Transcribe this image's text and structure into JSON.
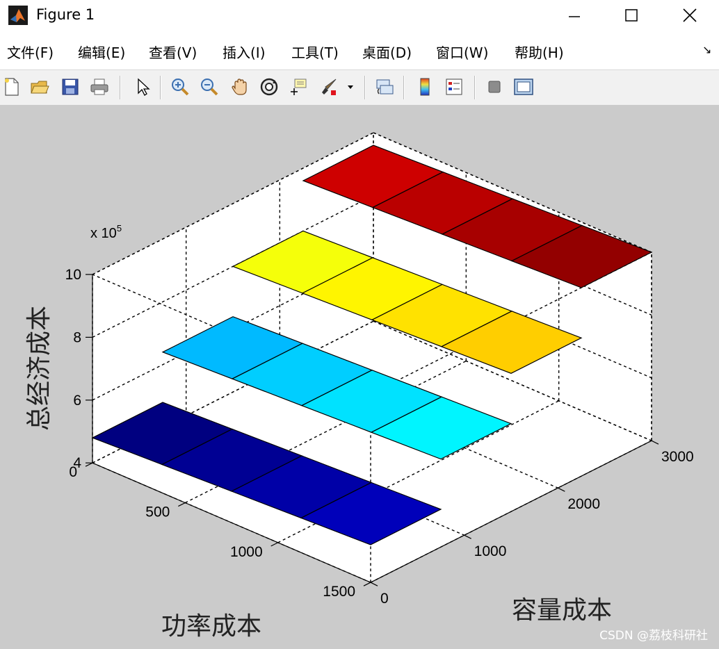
{
  "window": {
    "title": "Figure 1"
  },
  "menu": [
    {
      "label": "文件(F)"
    },
    {
      "label": "编辑(E)"
    },
    {
      "label": "查看(V)"
    },
    {
      "label": "插入(I)"
    },
    {
      "label": "工具(T)"
    },
    {
      "label": "桌面(D)"
    },
    {
      "label": "窗口(W)"
    },
    {
      "label": "帮助(H)"
    }
  ],
  "toolbar": {
    "icons": [
      "new-figure-icon",
      "open-file-icon",
      "save-icon",
      "print-icon",
      "pointer-icon",
      "zoom-in-icon",
      "zoom-out-icon",
      "pan-hand-icon",
      "rotate-3d-icon",
      "data-cursor-icon",
      "brush-icon",
      "link-plot-icon",
      "colorbar-icon",
      "legend-icon",
      "hide-plot-tools-icon",
      "show-plot-tools-icon"
    ]
  },
  "chart_data": {
    "type": "surface",
    "xlabel": "功率成本",
    "ylabel": "容量成本",
    "zlabel": "总经济成本",
    "exponent_label": "x 10",
    "exponent": "5",
    "x": [
      0,
      375,
      750,
      1125,
      1500
    ],
    "y": [
      0,
      750,
      1500,
      2250,
      3000
    ],
    "z_scale": 100000,
    "z": [
      [
        4.8,
        4.9,
        5.0,
        5.1,
        5.2
      ],
      [
        6.4,
        6.5,
        6.6,
        6.7,
        6.8
      ],
      [
        8.0,
        8.1,
        8.2,
        8.3,
        8.4
      ],
      [
        9.6,
        9.7,
        9.8,
        9.9,
        10.0
      ]
    ],
    "xticks": [
      "0",
      "500",
      "1000",
      "1500"
    ],
    "yticks": [
      "0",
      "1000",
      "2000",
      "3000"
    ],
    "zticks": [
      "4",
      "6",
      "8",
      "10"
    ],
    "xlim": [
      0,
      1500
    ],
    "ylim": [
      0,
      3000
    ],
    "zlim": [
      4,
      10
    ],
    "colormap": "jet",
    "grid": true
  },
  "watermark": "CSDN @荔枝科研社"
}
